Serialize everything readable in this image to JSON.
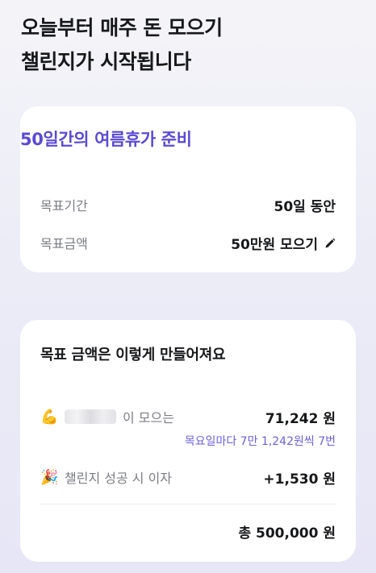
{
  "headline": {
    "line1": "오늘부터 매주 돈 모으기",
    "line2": "챌린지가 시작됩니다"
  },
  "challenge": {
    "title": "50일간의 여름휴가 준비",
    "period_label": "목표기간",
    "period_value": "50일 동안",
    "amount_label": "목표금액",
    "amount_value": "50만원 모으기",
    "edit_icon": "pencil-icon"
  },
  "breakdown": {
    "title": "목표 금액은 이렇게 만들어져요",
    "deposit": {
      "icon": "flexed-biceps-emoji",
      "label_suffix": "이 모으는",
      "amount": "71,242 원",
      "detail": "목요일마다 7만 1,242원씩 7번"
    },
    "interest": {
      "icon": "party-popper-emoji",
      "label": "챌린지 성공 시 이자",
      "amount": "+1,530 원"
    },
    "total": "총 500,000 원"
  },
  "colors": {
    "accent": "#5a4ad6",
    "accent_light": "#6b5fe0",
    "text": "#17181a",
    "muted": "#7b7d83"
  }
}
